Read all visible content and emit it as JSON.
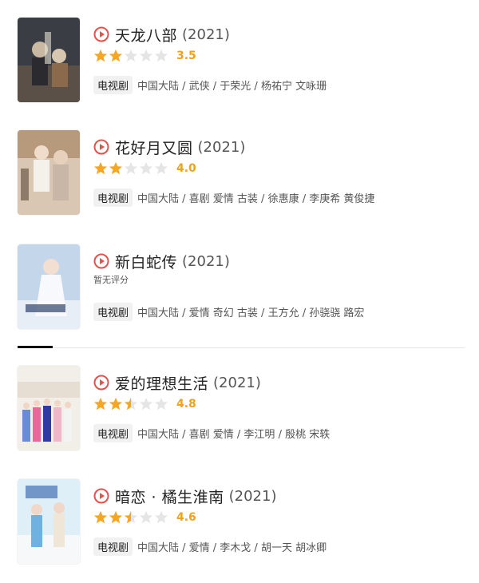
{
  "accent_color": "#e8504a",
  "star_color": "#f5a623",
  "items": [
    {
      "title": "天龙八部",
      "year": "(2021)",
      "rating": 3.5,
      "score": "3.5",
      "no_rating": "",
      "tag": "电视剧",
      "meta": "中国大陆 / 武侠 / 于荣光 / 杨祐宁 文咏珊",
      "stars_filled": 2,
      "poster_icon": "poster-tianlong"
    },
    {
      "title": "花好月又圆",
      "year": "(2021)",
      "rating": 4.0,
      "score": "4.0",
      "no_rating": "",
      "tag": "电视剧",
      "meta": "中国大陆 / 喜剧 爱情 古装 / 徐惠康 / 李庚希 黄俊捷",
      "stars_filled": 2,
      "poster_icon": "poster-huahao"
    },
    {
      "title": "新白蛇传",
      "year": "(2021)",
      "rating": null,
      "score": "",
      "no_rating": "暂无评分",
      "tag": "电视剧",
      "meta": "中国大陆 / 爱情 奇幻 古装 / 王方允 / 孙骁骁 路宏",
      "stars_filled": 0,
      "poster_icon": "poster-baishe"
    },
    {
      "title": "爱的理想生活",
      "year": "(2021)",
      "rating": 4.8,
      "score": "4.8",
      "no_rating": "",
      "tag": "电视剧",
      "meta": "中国大陆 / 喜剧 爱情 / 李江明 / 殷桃 宋轶",
      "stars_filled": 2.5,
      "poster_icon": "poster-aide"
    },
    {
      "title": "暗恋 · 橘生淮南",
      "year": "(2021)",
      "rating": 4.6,
      "score": "4.6",
      "no_rating": "",
      "tag": "电视剧",
      "meta": "中国大陆 / 爱情 / 李木戈 / 胡一天 胡冰卿",
      "stars_filled": 2.5,
      "poster_icon": "poster-anlian"
    }
  ]
}
